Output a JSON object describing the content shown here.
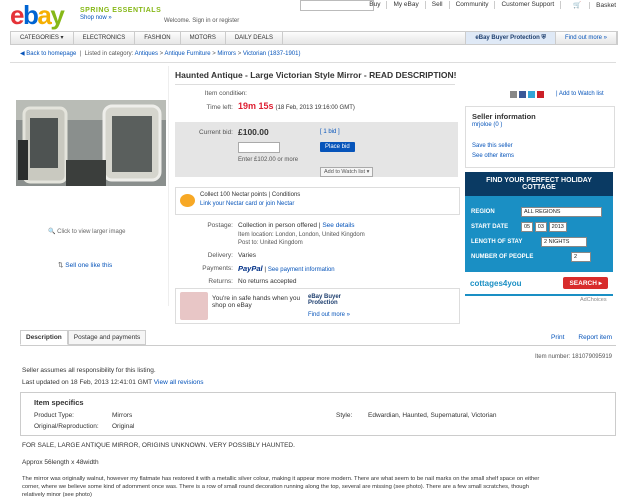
{
  "header": {
    "promo_title": "SPRING ESSENTIALS",
    "promo_link": "Shop now »",
    "welcome": "Welcome. Sign in or register",
    "topnav": [
      "Buy",
      "My eBay",
      "Sell",
      "Community",
      "Customer Support",
      "Basket"
    ]
  },
  "navbar": {
    "categories": "CATEGORIES ▾",
    "items": [
      "ELECTRONICS",
      "FASHION",
      "MOTORS",
      "DAILY DEALS"
    ],
    "buyer_protection": "eBay Buyer Protection",
    "find_out_more": "Find out more »"
  },
  "breadcrumb": {
    "back": "Back to homepage",
    "listed_in": "Listed in category:",
    "path": [
      "Antiques",
      "Antique Furniture",
      "Mirrors",
      "Victorian (1837-1901)"
    ]
  },
  "item": {
    "title": "Haunted Antique - Large Victorian Style Mirror - READ DESCRIPTION!",
    "condition_label": "Item condition:",
    "condition_value": "--",
    "time_left_label": "Time left:",
    "time_left": "19m 15s",
    "time_left_date": "(18 Feb, 2013  19:16:00 GMT)",
    "current_bid_label": "Current bid:",
    "current_bid": "£100.00",
    "bid_count": "[ 1 bid ]",
    "enter_hint": "Enter £102.00 or more",
    "place_bid": "Place bid",
    "add_watch": "Add to Watch list",
    "nectar_line1": "Collect 100 Nectar points | Conditions",
    "nectar_line2": "Link your Nectar card or join Nectar",
    "postage_label": "Postage:",
    "postage_value": "Collection in person offered",
    "postage_link": "See details",
    "item_location": "Item location: London, London, United Kingdom",
    "post_to": "Post to: United Kingdom",
    "delivery_label": "Delivery:",
    "delivery_value": "Varies",
    "payments_label": "Payments:",
    "payments_brand": "PayPal",
    "payments_link": "See payment information",
    "returns_label": "Returns:",
    "returns_value": "No returns accepted",
    "safe_hands": "You're in safe hands when you shop on eBay",
    "ebp_title": "eBay Buyer Protection",
    "ebp_link": "Find out more »",
    "add_to_watch_link": "Add to Watch list"
  },
  "images": {
    "enlarge": "Click to view larger image",
    "sell_one": "Sell one like this"
  },
  "seller": {
    "heading": "Seller information",
    "name": "mrjoloe (0 )",
    "save": "Save this seller",
    "other": "See other items"
  },
  "ad": {
    "headline": "FIND YOUR PERFECT HOLIDAY COTTAGE",
    "region_label": "REGION",
    "region_value": "ALL REGIONS",
    "start_label": "START DATE",
    "start_d": "05",
    "start_m": "03",
    "start_y": "2013",
    "stay_label": "LENGTH OF STAY",
    "stay_value": "2 NIGHTS",
    "people_label": "NUMBER OF PEOPLE",
    "people_value": "2",
    "brand": "cottages4you",
    "search": "SEARCH ▸",
    "adchoices": "AdChoices"
  },
  "tabs": [
    "Description",
    "Postage and payments"
  ],
  "tools": [
    "Print",
    "Report item"
  ],
  "description": {
    "item_number": "Item number:  181079095919",
    "responsibility": "Seller assumes all responsibility for this listing.",
    "last_updated": "Last updated on  18 Feb, 2013 12:41:01 GMT",
    "view_revisions": "View all revisions",
    "specifics_title": "Item specifics",
    "product_type_label": "Product Type:",
    "product_type": "Mirrors",
    "orig_label": "Original/Reproduction:",
    "orig_value": "Original",
    "style_label": "Style:",
    "style_value": "Edwardian, Haunted, Supernatural, Victorian",
    "line1": "FOR SALE, LARGE ANTIQUE MIRROR, ORIGINS UNKNOWN. VERY POSSIBLY HAUNTED.",
    "line2": "Approx 56length x 48width",
    "line3": "The mirror was originally walnut, however my flatmate has restored it with a metallic silver colour, making it appear more modern. There are what seem to be nail marks on the small shelf space on either",
    "line4": "corner, where we believe some kind of adornment once was. There is a row of small round decoration running along the top, several are missing (see photo). There are a few small scratches, though",
    "line5": "relatively minor (see photo)"
  }
}
